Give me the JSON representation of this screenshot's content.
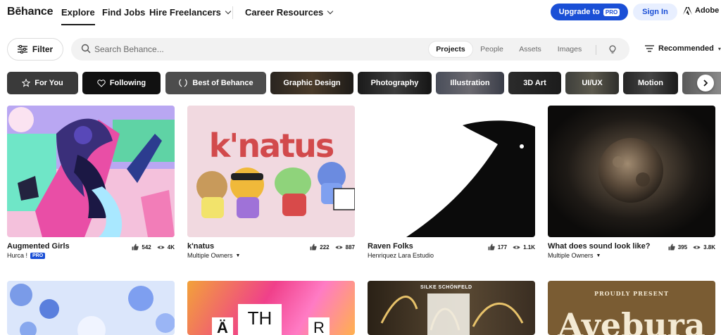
{
  "header": {
    "logo": "Bēhance",
    "nav": [
      {
        "label": "Explore"
      },
      {
        "label": "Find Jobs"
      },
      {
        "label": "Hire Freelancers"
      },
      {
        "label": "Career Resources"
      }
    ],
    "upgrade_label": "Upgrade to",
    "upgrade_badge": "PRO",
    "signin_label": "Sign In",
    "adobe_label": "Adobe"
  },
  "search": {
    "filter_label": "Filter",
    "placeholder": "Search Behance...",
    "value": "",
    "tabs": [
      "Projects",
      "People",
      "Assets",
      "Images"
    ],
    "active_tab": "Projects",
    "sort_label": "Recommended"
  },
  "categories": [
    {
      "label": "For You",
      "icon": "star-icon"
    },
    {
      "label": "Following",
      "icon": "heart-icon"
    },
    {
      "label": "Best of Behance",
      "icon": "laurel-icon"
    },
    {
      "label": "Graphic Design"
    },
    {
      "label": "Photography"
    },
    {
      "label": "Illustration"
    },
    {
      "label": "3D Art"
    },
    {
      "label": "UI/UX"
    },
    {
      "label": "Motion"
    }
  ],
  "projects": [
    {
      "title": "Augmented Girls",
      "owner": "Hurca !",
      "owner_badge": "PRO",
      "likes": "542",
      "views": "4K"
    },
    {
      "title": "k'natus",
      "owner": "Multiple Owners",
      "likes": "222",
      "views": "887",
      "thumb_text": "k'natus"
    },
    {
      "title": "Raven Folks",
      "owner": "Henriquez Lara Estudio",
      "likes": "177",
      "views": "1.1K"
    },
    {
      "title": "What does sound look like?",
      "owner": "Multiple Owners",
      "likes": "395",
      "views": "3.8K"
    }
  ],
  "row2_thumbs": {
    "second_text_a": "Ä",
    "second_text_b": "TH",
    "second_text_c": "R",
    "third_overlay": "SILKE SCHÖNFELD",
    "fourth_overlay": "PROUDLY PRESENT",
    "fourth_word": "Avebura"
  },
  "colors": {
    "brand_blue": "#1a4fd6",
    "signin_bg": "#e8efff"
  }
}
